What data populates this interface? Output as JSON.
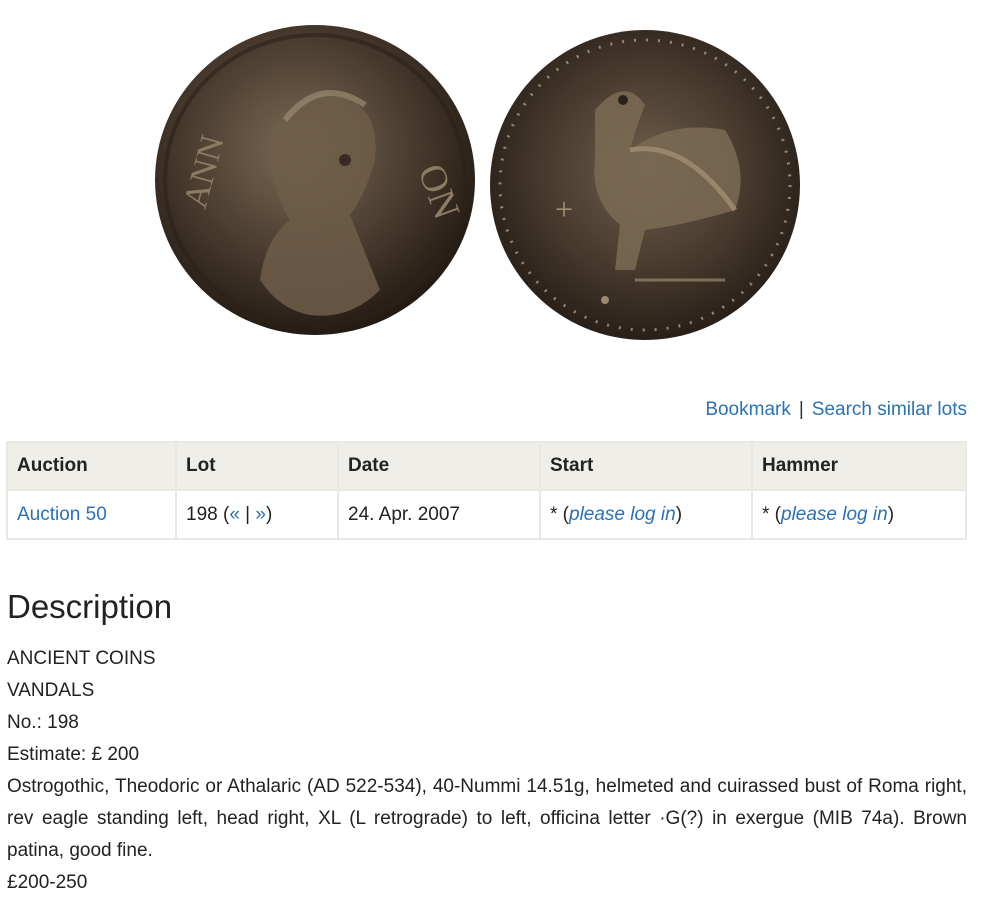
{
  "images": {
    "obverse": {
      "icon": "coin-obverse-image"
    },
    "reverse": {
      "icon": "coin-reverse-image"
    }
  },
  "actions": {
    "bookmark": "Bookmark",
    "separator": "|",
    "search_similar": "Search similar lots"
  },
  "table": {
    "headers": [
      "Auction",
      "Lot",
      "Date",
      "Start",
      "Hammer"
    ],
    "row": {
      "auction": "Auction 50",
      "lot_number": "198 (",
      "lot_prev": "«",
      "lot_sep": " | ",
      "lot_next": "»",
      "lot_close": ")",
      "date": "24. Apr. 2007",
      "start_prefix": "* (",
      "start_link": "please log in",
      "start_suffix": ")",
      "hammer_prefix": "* (",
      "hammer_link": "please log in",
      "hammer_suffix": ")"
    }
  },
  "description": {
    "title": "Description",
    "category": "ANCIENT COINS",
    "subcategory": "VANDALS",
    "number": "No.: 198",
    "estimate": "Estimate: £ 200",
    "text": "Ostrogothic, Theodoric or Athalaric (AD 522-534), 40-Nummi 14.51g, helmeted and cuirassed bust of Roma right, rev eagle standing left, head right, XL (L retrograde) to left, officina letter ·G(?) in exergue (MIB 74a). Brown patina, good fine.",
    "range": "£200-250"
  },
  "colors": {
    "link": "#2a72b5",
    "header_bg": "#efeee9",
    "border": "#eae8e2",
    "text": "#222222"
  }
}
